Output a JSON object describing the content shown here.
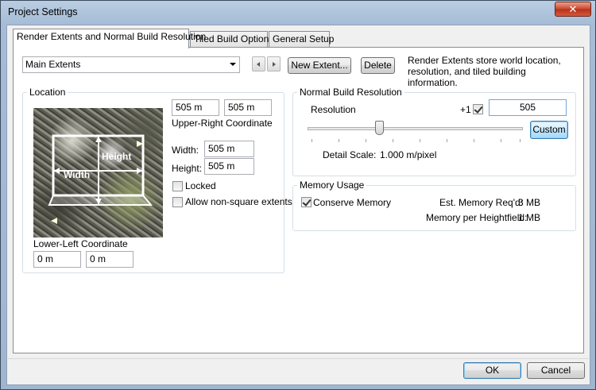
{
  "window": {
    "title": "Project Settings",
    "close_glyph": "✕"
  },
  "tabs": [
    {
      "label": "Render Extents and Normal Build Resolution",
      "active": true
    },
    {
      "label": "Tiled Build Options",
      "active": false
    },
    {
      "label": "General Setup",
      "active": false
    }
  ],
  "extents": {
    "selected": "Main Extents",
    "new_button": "New Extent...",
    "delete_button": "Delete",
    "description": "Render Extents store world location, resolution, and tiled building information."
  },
  "location": {
    "title": "Location",
    "upper_right_x": "505 m",
    "upper_right_y": "505 m",
    "upper_right_label": "Upper-Right Coordinate",
    "width_label": "Width:",
    "width_value": "505 m",
    "height_label": "Height:",
    "height_value": "505 m",
    "locked_label": "Locked",
    "locked_checked": false,
    "nonsquare_label": "Allow non-square extents",
    "nonsquare_checked": false,
    "lower_left_label": "Lower-Left Coordinate",
    "lower_left_x": "0 m",
    "lower_left_y": "0 m",
    "image_width_label": "Width",
    "image_height_label": "Height"
  },
  "resolution": {
    "title": "Normal Build Resolution",
    "label": "Resolution",
    "plus_one_label": "+1",
    "plus_one_checked": true,
    "value": "505",
    "custom_button": "Custom",
    "detail_label": "Detail Scale:",
    "detail_value": "1.000 m/pixel",
    "slider_fraction": 0.33
  },
  "memory": {
    "title": "Memory Usage",
    "conserve_label": "Conserve Memory",
    "conserve_checked": true,
    "req_label": "Est. Memory Req'd:",
    "req_value": "3 MB",
    "per_label": "Memory per Heightfield:",
    "per_value": "1 MB"
  },
  "footer": {
    "ok": "OK",
    "cancel": "Cancel"
  },
  "colors": {
    "titlebar": "#b9cde2",
    "close": "#c9462c",
    "default_border": "#3c7fb1"
  }
}
